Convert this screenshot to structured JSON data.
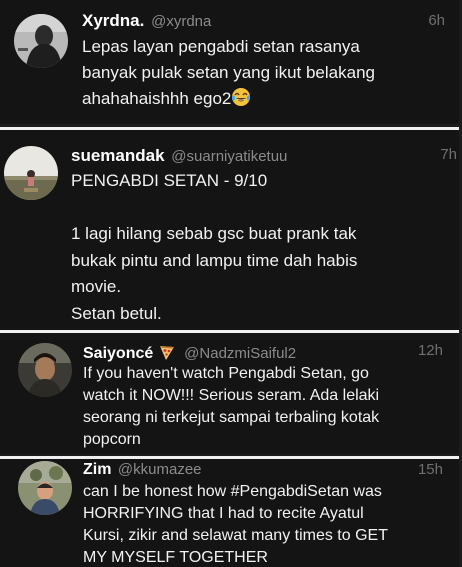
{
  "tweets": [
    {
      "name": "Xyrdna.",
      "handle": "@xyrdna",
      "time": "6h",
      "text": "Lepas layan pengabdi setan rasanya\nbanyak pulak setan yang ikut belakang\nahahahaishhh ego2",
      "trailing_emoji": "laughing-tears-emoji"
    },
    {
      "name": "suemandak",
      "handle": "@suarniyatiketuu",
      "time": "7h",
      "text": "PENGABDI SETAN - 9/10\n\n1 lagi hilang sebab gsc buat prank tak\nbukak pintu and lampu time dah habis\nmovie.\nSetan betul."
    },
    {
      "name": "Saiyoncé",
      "name_emoji": "pizza-emoji",
      "handle": "@NadzmiSaiful2",
      "time": "12h",
      "text": "If you haven't watch Pengabdi Setan, go\nwatch it NOW!!! Serious seram. Ada lelaki\nseorang ni terkejut sampai terbaling kotak\npopcorn"
    },
    {
      "name": "Zim",
      "handle": "@kkumazee",
      "time": "15h",
      "text": "can I be honest how #PengabdiSetan was\nHORRIFYING that I had to recite Ayatul\nKursi, zikir and selawat many times to GET\nMY MYSELF TOGETHER"
    }
  ],
  "colors": {
    "background": "#141414",
    "divider": "#f0f0f0",
    "name": "#ffffff",
    "handle": "#8b8b8b",
    "timestamp": "#6f6f6f",
    "body_text": "#f2f2f2"
  }
}
